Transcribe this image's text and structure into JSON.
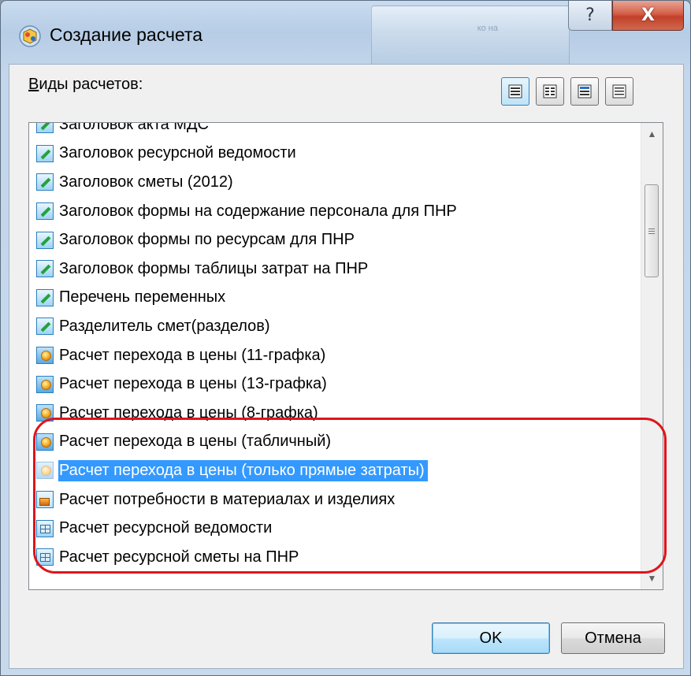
{
  "window": {
    "title": "Создание расчета",
    "help_glyph": "?",
    "close_glyph": "X",
    "background_caption": "ко на"
  },
  "calc_types": {
    "label_accel": "В",
    "label_rest": "иды расчетов:"
  },
  "view_buttons": [
    {
      "name": "details-view",
      "active": true
    },
    {
      "name": "list-view",
      "active": false
    },
    {
      "name": "small-icons-view",
      "active": false
    },
    {
      "name": "tiles-view",
      "active": false
    }
  ],
  "list": {
    "items": [
      {
        "label": "Заголовок акта МДС",
        "icon": "edit"
      },
      {
        "label": "Заголовок ресурсной ведомости",
        "icon": "edit"
      },
      {
        "label": "Заголовок сметы (2012)",
        "icon": "edit"
      },
      {
        "label": "Заголовок формы на содержание персонала для ПНР",
        "icon": "edit"
      },
      {
        "label": "Заголовок формы по ресурсам для ПНР",
        "icon": "edit"
      },
      {
        "label": "Заголовок формы таблицы затрат на ПНР",
        "icon": "edit"
      },
      {
        "label": "Перечень переменных",
        "icon": "edit"
      },
      {
        "label": "Разделитель смет(разделов)",
        "icon": "edit"
      },
      {
        "label": "Расчет перехода в цены (11-графка)",
        "icon": "coin"
      },
      {
        "label": "Расчет перехода в цены (13-графка)",
        "icon": "coin"
      },
      {
        "label": "Расчет перехода в цены (8-графка)",
        "icon": "coin"
      },
      {
        "label": "Расчет перехода в цены (табличный)",
        "icon": "coin"
      },
      {
        "label": "Расчет перехода в цены (только прямые затраты)",
        "icon": "coin",
        "selected": true
      },
      {
        "label": "Расчет потребности в материалах и изделиях",
        "icon": "box"
      },
      {
        "label": "Расчет ресурсной ведомости",
        "icon": "grid"
      },
      {
        "label": "Расчет ресурсной сметы на ПНР",
        "icon": "grid"
      }
    ],
    "scroll_up_glyph": "▲",
    "scroll_down_glyph": "▼"
  },
  "buttons": {
    "ok": "OK",
    "cancel": "Отмена"
  },
  "colors": {
    "selection": "#3399ff",
    "highlight_ring": "#e0141b"
  }
}
